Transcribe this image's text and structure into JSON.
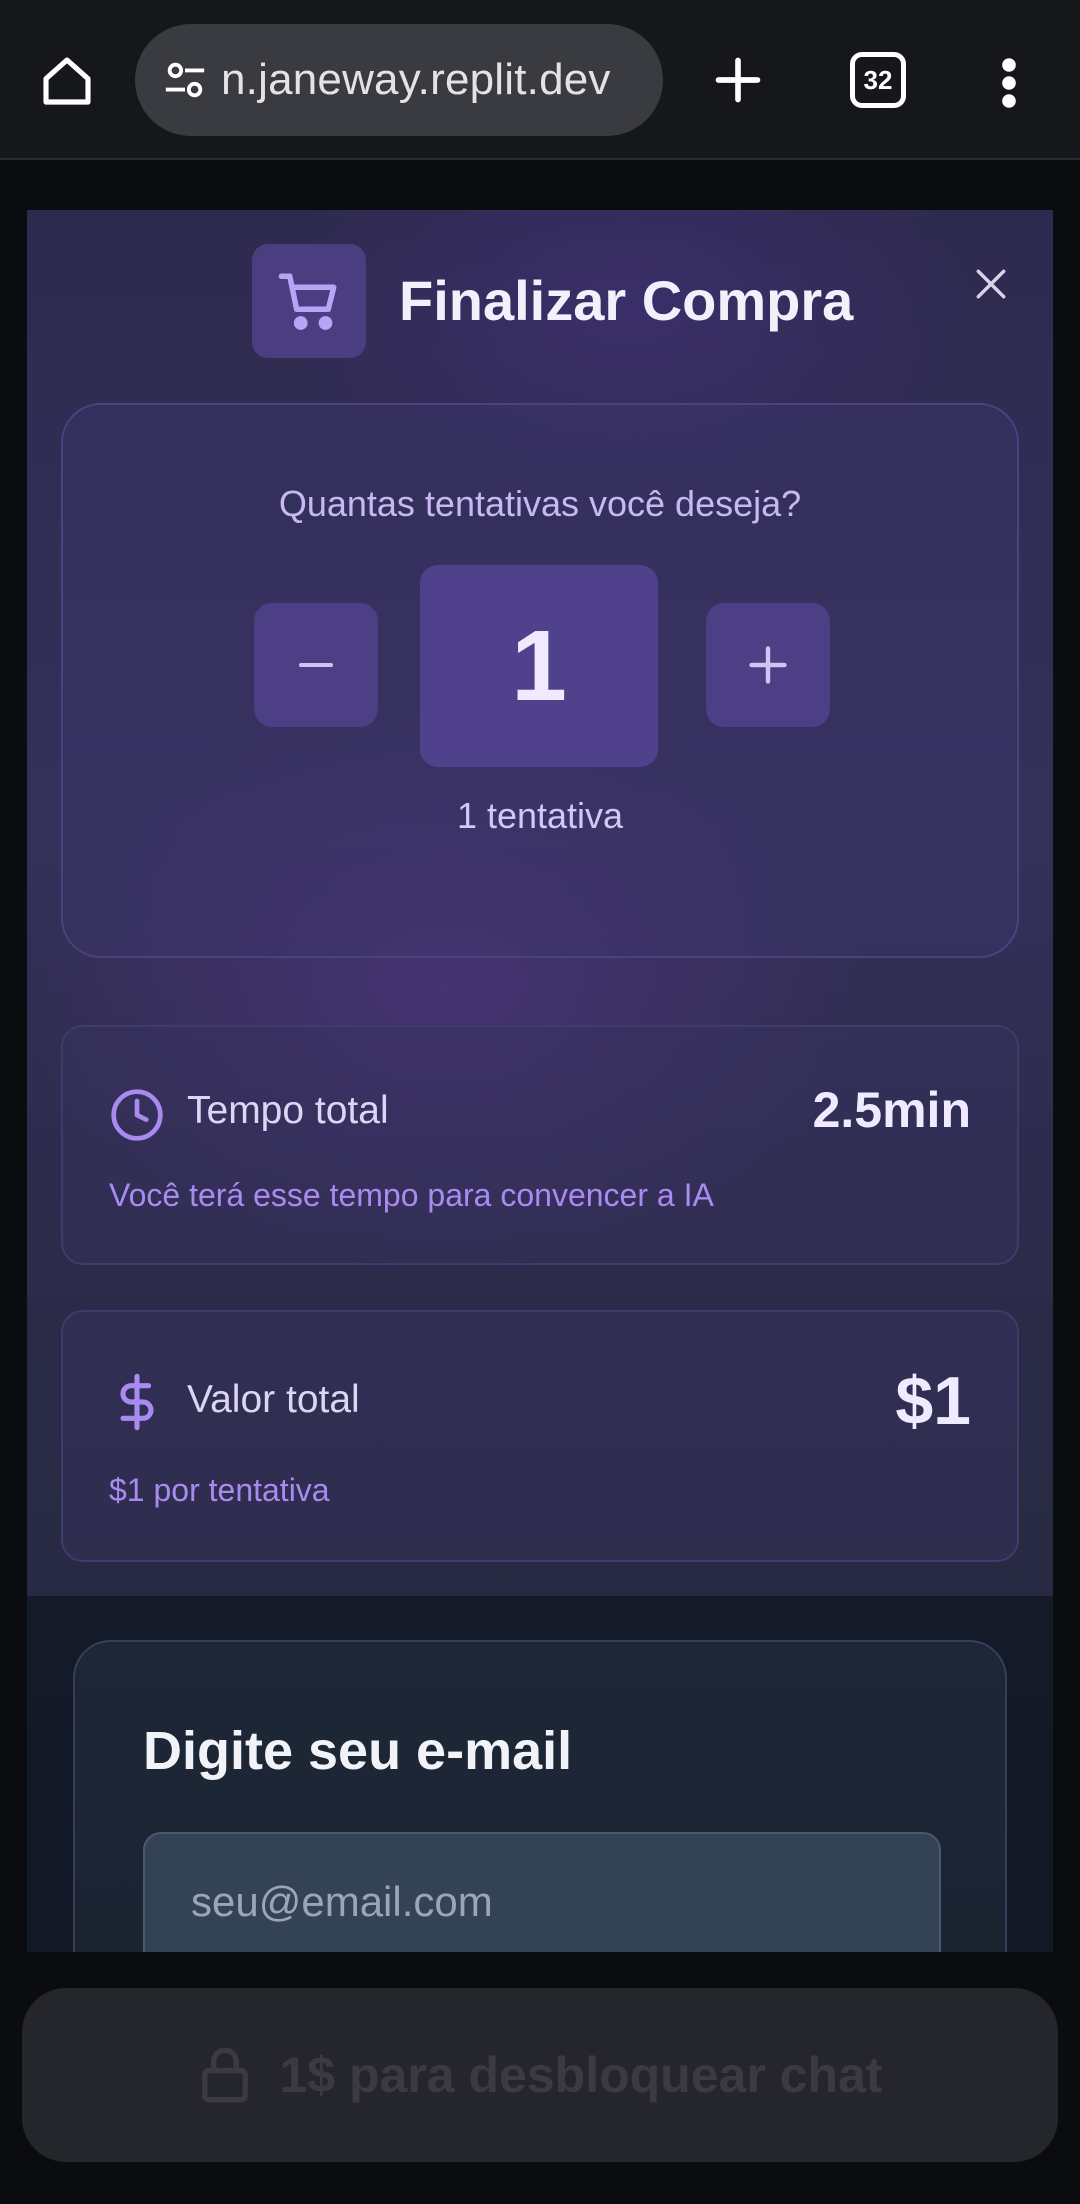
{
  "browser": {
    "url": "n.janeway.replit.dev",
    "tab_count": "32"
  },
  "modal": {
    "title": "Finalizar Compra",
    "quantity": {
      "question": "Quantas tentativas você deseja?",
      "value": "1",
      "caption": "1 tentativa"
    },
    "time": {
      "label": "Tempo total",
      "value": "2.5min",
      "note": "Você terá esse tempo para convencer a IA"
    },
    "price": {
      "label": "Valor total",
      "value": "$1",
      "note": "$1 por tentativa"
    },
    "email": {
      "title": "Digite seu e-mail",
      "placeholder": "seu@email.com",
      "value": ""
    }
  },
  "footer": {
    "unlock_label": "1$ para desbloquear chat"
  },
  "colors": {
    "accent": "#4c3f86",
    "accent_text": "#a98af0",
    "modal_bg": "#2e2a4f",
    "button_disabled": "#25252c"
  },
  "icons": {
    "home": "home-icon",
    "site_settings": "tune-icon",
    "new_tab": "plus-icon",
    "tabs": "tab-switcher-icon",
    "menu": "more-vert-icon",
    "cart": "shopping-cart-icon",
    "close": "close-icon",
    "minus": "minus-icon",
    "plus": "plus-icon",
    "clock": "clock-icon",
    "dollar": "dollar-icon",
    "lock": "lock-icon"
  }
}
